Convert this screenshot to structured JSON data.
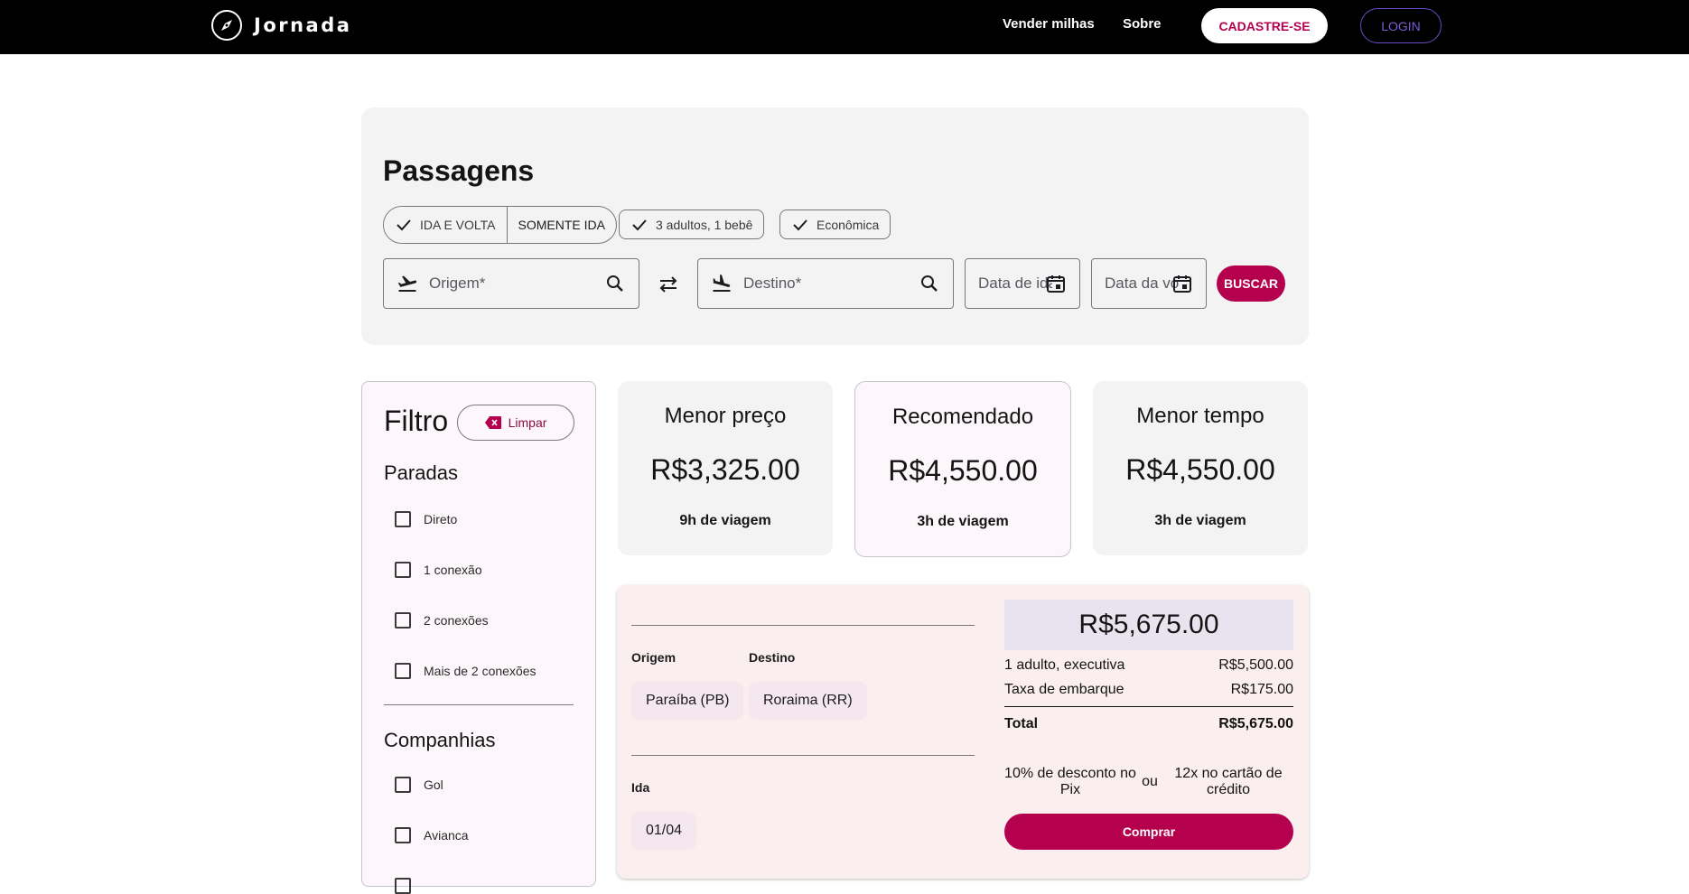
{
  "header": {
    "brand": "Jornada",
    "nav": [
      "Vender milhas",
      "Sobre"
    ],
    "signup_label": "CADASTRE-SE",
    "login_label": "LOGIN"
  },
  "search": {
    "title": "Passagens",
    "trip_type": [
      "IDA E VOLTA",
      "SOMENTE IDA"
    ],
    "passengers": "3 adultos, 1 bebê",
    "cabin": "Econômica",
    "origin_placeholder": "Origem*",
    "destination_placeholder": "Destino*",
    "departure_placeholder": "Data de ida",
    "return_placeholder": "Data da volta",
    "search_label": "BUSCAR"
  },
  "filter": {
    "title": "Filtro",
    "clear_label": "Limpar",
    "stops_title": "Paradas",
    "stops": [
      "Direto",
      "1 conexão",
      "2 conexões",
      "Mais de 2 conexões"
    ],
    "airlines_title": "Companhias",
    "airlines": [
      "Gol",
      "Avianca"
    ]
  },
  "price_cards": [
    {
      "title": "Menor preço",
      "value": "R$3,325.00",
      "duration": "9h de viagem"
    },
    {
      "title": "Recomendado",
      "value": "R$4,550.00",
      "duration": "3h de viagem"
    },
    {
      "title": "Menor tempo",
      "value": "R$4,550.00",
      "duration": "3h de viagem"
    }
  ],
  "ticket": {
    "origin_label": "Origem",
    "destination_label": "Destino",
    "origin": "Paraíba (PB)",
    "destination": "Roraima (RR)",
    "departure_label": "Ida",
    "departure_date": "01/04",
    "total_price": "R$5,675.00",
    "fare_label": "1 adulto, executiva",
    "fare_value": "R$5,500.00",
    "tax_label": "Taxa de embarque",
    "tax_value": "R$175.00",
    "total_label": "Total",
    "total_value": "R$5,675.00",
    "pix_offer": "10% de desconto no Pix",
    "or_label": "ou",
    "card_offer": "12x no cartão de crédito",
    "buy_label": "Comprar"
  },
  "colors": {
    "brand": "#b5004e",
    "header_bg": "#000000",
    "panel_bg": "#f3f3f3",
    "ticket_bg": "#fbeeee"
  }
}
